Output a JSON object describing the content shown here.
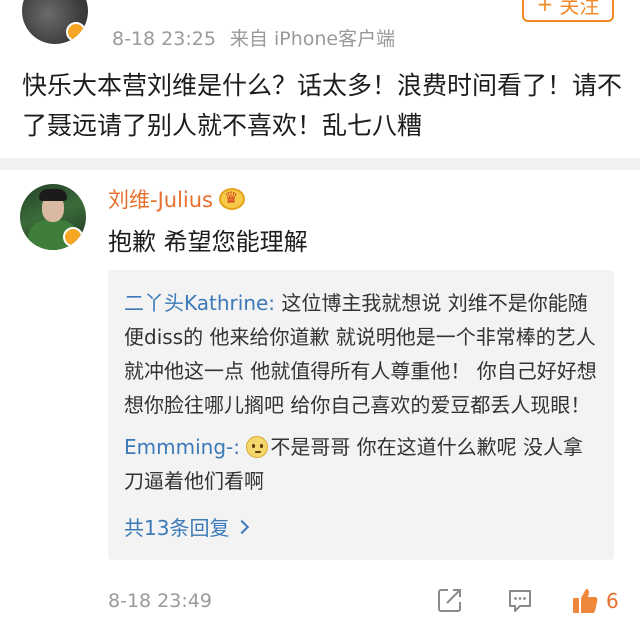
{
  "post": {
    "time": "8-18 23:25",
    "source": "来自 iPhone客户端",
    "follow_label": "关注",
    "text": "快乐大本营刘维是什么？话太多！浪费时间看了！请不了聂远请了别人就不喜欢！乱七八糟"
  },
  "reply": {
    "author": "刘维-Julius",
    "text": "抱歉 希望您能理解",
    "sub_comments": [
      {
        "user": "二丫头Kathrine:",
        "text": " 这位博主我就想说 刘维不是你能随便diss的 他来给你道歉 就说明他是一个非常棒的艺人 就冲他这一点 他就值得所有人尊重他！ 你自己好好想想你脸往哪儿搁吧 给你自己喜欢的爱豆都丢人现眼！"
      },
      {
        "user": "Emmming-:",
        "text": "不是哥哥 你在这道什么歉呢 没人拿刀逼着他们看啊"
      }
    ],
    "more_replies": "共13条回复",
    "time": "8-18 23:49",
    "like_count": "6"
  },
  "icons": {
    "share": "share-icon",
    "comment": "comment-icon",
    "like": "thumbs-up-icon",
    "chevron": "chevron-right-icon",
    "emoji": "confused-face-emoji-icon"
  },
  "colors": {
    "accent": "#e7702c",
    "link": "#3b79b8",
    "meta": "#9a9a9a",
    "subbox_bg": "#f3f3f3",
    "divider": "#f2f2f2"
  }
}
